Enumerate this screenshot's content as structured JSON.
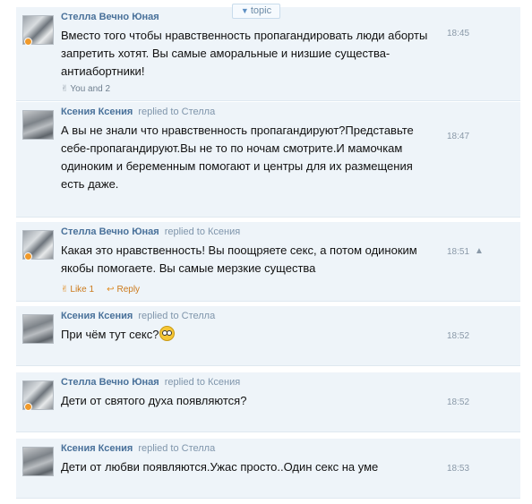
{
  "topic_tab": {
    "label": "topic",
    "icon": "triangle-down-icon"
  },
  "messages": [
    {
      "author": "Стелла Вечно Юная",
      "replied_to": "",
      "text": "Вместо того чтобы нравственность пропагандировать люди аборты запретить хотят. Вы самые аморальные и низшие существа-антиабортники!",
      "time": "18:45",
      "likes": "You and 2"
    },
    {
      "author": "Ксения Ксения",
      "replied_to": "replied to Стелла",
      "text": "А вы не знали что нравственность пропагандируют?Представьте себе-пропагандируют.Вы не то по ночам смотрите.И мамочкам одиноким и беременным помогают и центры для их размещения есть даже.",
      "time": "18:47"
    },
    {
      "author": "Стелла Вечно Юная",
      "replied_to": "replied to Ксения",
      "text": "Какая это нравственность! Вы поощряете секс, а потом одиноким якобы помогаете. Вы самые мерзкие существа",
      "time": "18:51",
      "warning_icon": "▲",
      "like_label": "Like 1",
      "reply_label": "Reply"
    },
    {
      "author": "Ксения Ксения",
      "replied_to": "replied to Стелла",
      "text": "При чём тут секс?",
      "time": "18:52"
    },
    {
      "author": "Стелла Вечно Юная",
      "replied_to": "replied to Ксения",
      "text": "Дети от святого духа появляются?",
      "time": "18:52"
    },
    {
      "author": "Ксения Ксения",
      "replied_to": "replied to Стелла",
      "text": "Дети от любви появляются.Ужас просто..Один секс на уме",
      "time": "18:53"
    }
  ]
}
